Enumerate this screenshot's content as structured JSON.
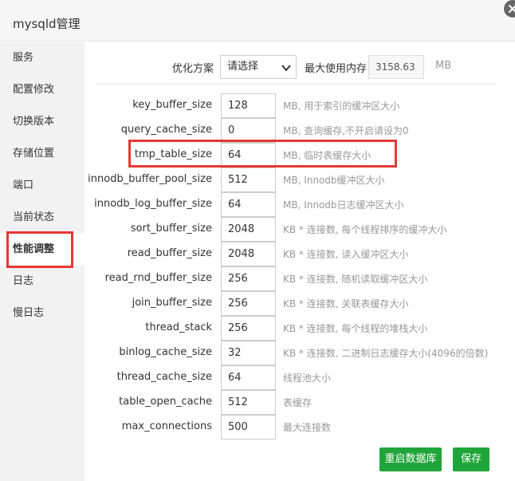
{
  "window": {
    "title": "mysqld管理"
  },
  "sidebar": {
    "items": [
      {
        "label": "服务"
      },
      {
        "label": "配置修改"
      },
      {
        "label": "切换版本"
      },
      {
        "label": "存储位置"
      },
      {
        "label": "端口"
      },
      {
        "label": "当前状态"
      },
      {
        "label": "性能调整",
        "active": true
      },
      {
        "label": "日志"
      },
      {
        "label": "慢日志"
      }
    ]
  },
  "optimize": {
    "label": "优化方案",
    "select_value": "请选择",
    "maxmem_label": "最大使用内存",
    "maxmem_value": "3158.63",
    "maxmem_unit": "MB"
  },
  "params": [
    {
      "name": "key_buffer_size",
      "value": "128",
      "desc": "MB, 用于索引的缓冲区大小"
    },
    {
      "name": "query_cache_size",
      "value": "0",
      "desc": "MB, 查询缓存,不开启请设为0"
    },
    {
      "name": "tmp_table_size",
      "value": "64",
      "desc": "MB, 临时表缓存大小"
    },
    {
      "name": "innodb_buffer_pool_size",
      "value": "512",
      "desc": "MB, Innodb缓冲区大小"
    },
    {
      "name": "innodb_log_buffer_size",
      "value": "64",
      "desc": "MB, Innodb日志缓冲区大小"
    },
    {
      "name": "sort_buffer_size",
      "value": "2048",
      "desc": "KB * 连接数, 每个线程排序的缓冲大小"
    },
    {
      "name": "read_buffer_size",
      "value": "2048",
      "desc": "KB * 连接数, 读入缓冲区大小"
    },
    {
      "name": "read_rnd_buffer_size",
      "value": "256",
      "desc": "KB * 连接数, 随机读取缓冲区大小"
    },
    {
      "name": "join_buffer_size",
      "value": "256",
      "desc": "KB * 连接数, 关联表缓存大小"
    },
    {
      "name": "thread_stack",
      "value": "256",
      "desc": "KB * 连接数, 每个线程的堆栈大小"
    },
    {
      "name": "binlog_cache_size",
      "value": "32",
      "desc": "KB * 连接数, 二进制日志缓存大小(4096的倍数)"
    },
    {
      "name": "thread_cache_size",
      "value": "64",
      "desc": "线程池大小"
    },
    {
      "name": "table_open_cache",
      "value": "512",
      "desc": "表缓存"
    },
    {
      "name": "max_connections",
      "value": "500",
      "desc": "最大连接数"
    }
  ],
  "buttons": {
    "restart": "重启数据库",
    "save": "保存"
  },
  "colors": {
    "accent": "#20a53a",
    "highlight": "#e53935",
    "sidebar_bg": "#f2f2f2"
  }
}
